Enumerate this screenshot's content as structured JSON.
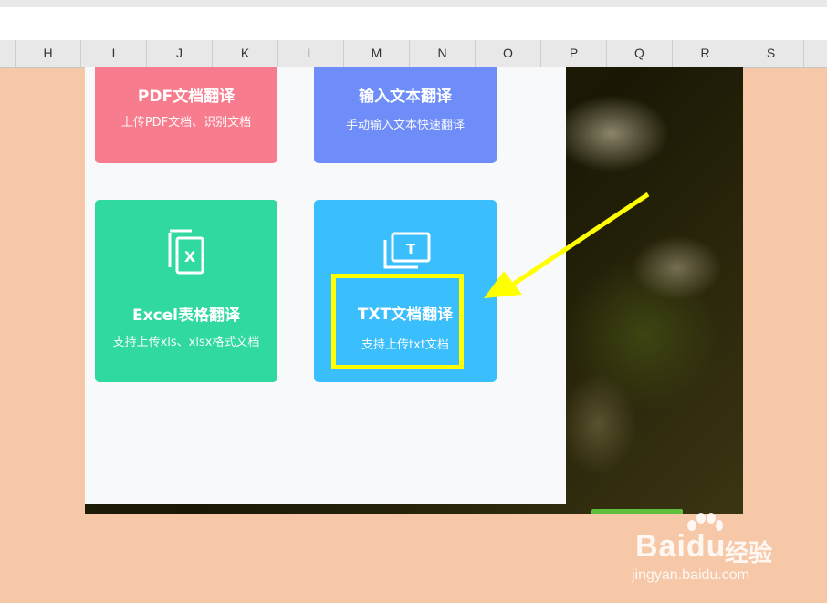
{
  "spreadsheet": {
    "columns": [
      "H",
      "I",
      "J",
      "K",
      "L",
      "M",
      "N",
      "O",
      "P",
      "Q",
      "R",
      "S"
    ]
  },
  "cards": {
    "pdf": {
      "title": "PDF文档翻译",
      "subtitle": "上传PDF文档、识别文档",
      "color": "#f77d8e"
    },
    "text": {
      "title": "输入文本翻译",
      "subtitle": "手动输入文本快速翻译",
      "color": "#6e8df8"
    },
    "excel": {
      "title": "Excel表格翻译",
      "subtitle": "支持上传xls、xlsx格式文档",
      "icon_letter": "X",
      "icon": "excel-file-icon",
      "color": "#2fd9a0"
    },
    "txt": {
      "title": "TXT文档翻译",
      "subtitle": "支持上传txt文档",
      "icon_letter": "T",
      "icon": "txt-file-icon",
      "color": "#3bbefc"
    }
  },
  "annotations": {
    "highlight_color": "#ffff00",
    "arrow_color": "#ffff00"
  },
  "watermark": {
    "logo_text": "Baidu",
    "cn_text": "经验",
    "url": "jingyan.baidu.com"
  }
}
